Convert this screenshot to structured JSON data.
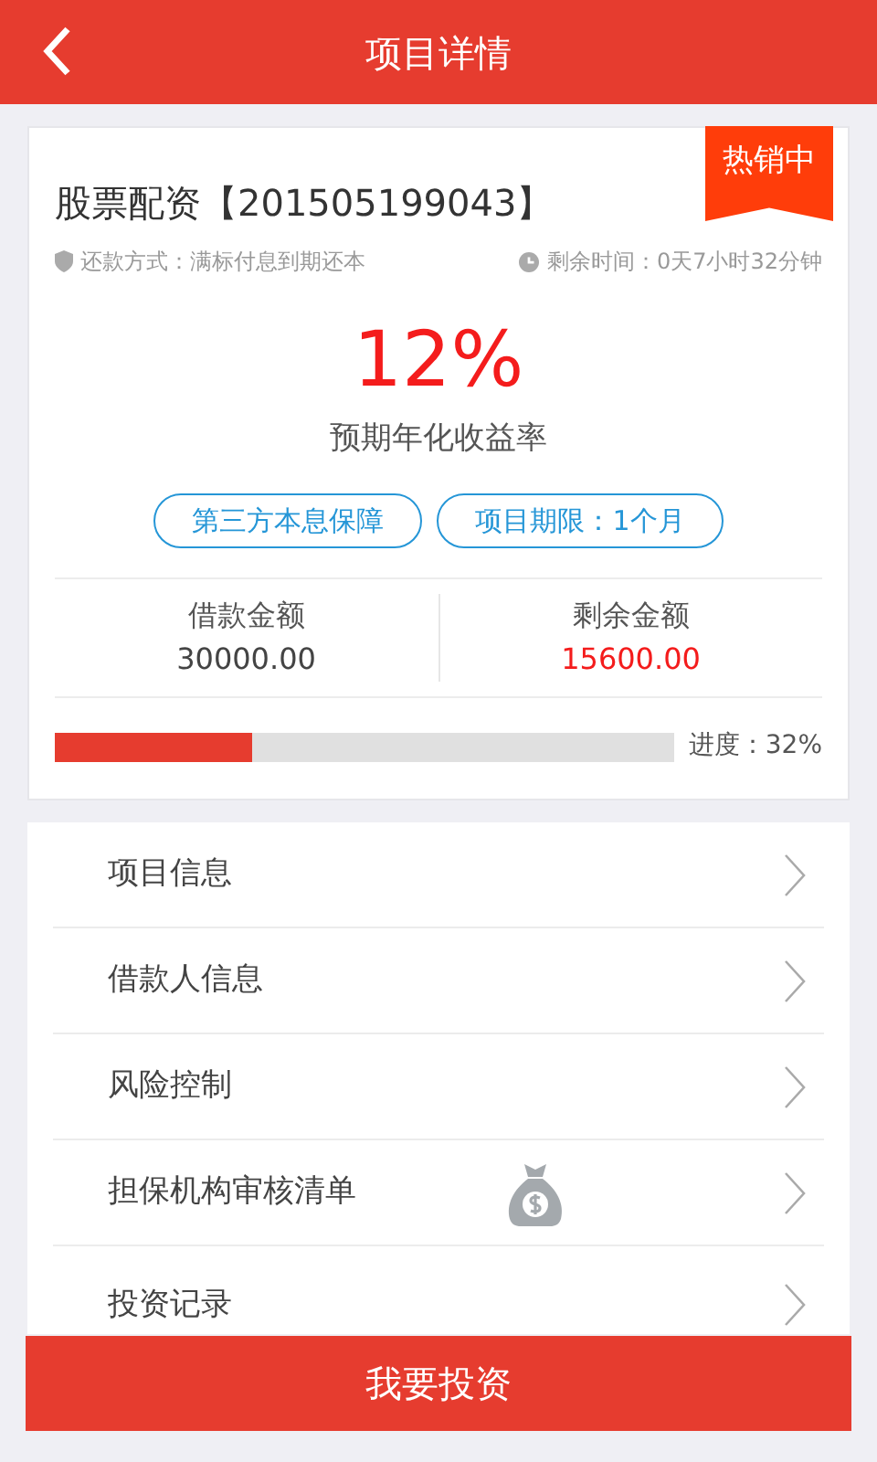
{
  "header": {
    "title": "项目详情"
  },
  "project": {
    "name": "股票配资【201505199043】",
    "ribbon": "热销中",
    "repayment": "还款方式：满标付息到期还本",
    "remaining_time": "剩余时间：0天7小时32分钟",
    "rate": "12%",
    "rate_label": "预期年化收益率",
    "tags": [
      "第三方本息保障",
      "项目期限：1个月"
    ],
    "amounts": [
      {
        "label": "借款金额",
        "value": "30000.00",
        "highlight": false
      },
      {
        "label": "剩余金额",
        "value": "15600.00",
        "highlight": true
      }
    ],
    "progress": {
      "level": 0.32,
      "label": "进度：32%"
    }
  },
  "menu": [
    {
      "label": "项目信息",
      "kind": "plain"
    },
    {
      "label": "借款人信息",
      "kind": "plain"
    },
    {
      "label": "风险控制",
      "kind": "plain"
    },
    {
      "label": "担保机构审核清单",
      "kind": "with-icon"
    },
    {
      "label": "投资记录",
      "kind": "plain"
    }
  ],
  "invest_button": "我要投资"
}
